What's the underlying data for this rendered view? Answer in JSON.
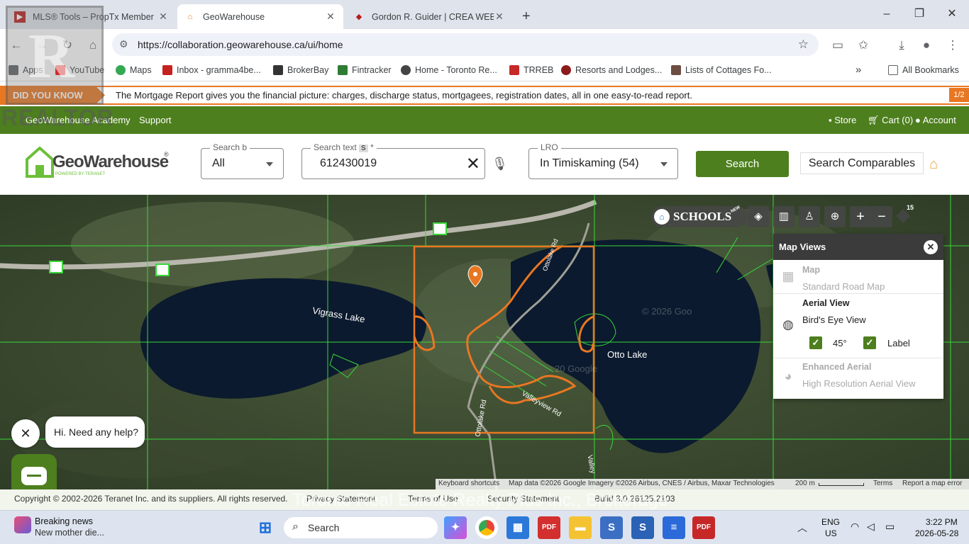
{
  "browser": {
    "tabs": [
      {
        "title": "MLS® Tools – PropTx Member",
        "active": false
      },
      {
        "title": "GeoWarehouse",
        "active": true
      },
      {
        "title": "Gordon R. Guider | CREA WEBF",
        "active": false
      }
    ],
    "new_tab": "+",
    "window_controls": {
      "minimize": "–",
      "maximize": "❐",
      "close": "✕"
    },
    "url": "https://collaboration.geowarehouse.ca/ui/home",
    "bookmarks": [
      {
        "label": "Apps",
        "color": "#5f6368"
      },
      {
        "label": "YouTube",
        "color": "#ff0000"
      },
      {
        "label": "Maps",
        "color": "#34a853"
      },
      {
        "label": "Inbox - gramma4be...",
        "color": "#c5221f"
      },
      {
        "label": "BrokerBay",
        "color": "#333333"
      },
      {
        "label": "Fintracker",
        "color": "#2e7d32"
      },
      {
        "label": "Home - Toronto Re...",
        "color": "#444444"
      },
      {
        "label": "TRREB",
        "color": "#c62828"
      },
      {
        "label": "Resorts and Lodges...",
        "color": "#8d1b1b"
      },
      {
        "label": "Lists of Cottages Fo...",
        "color": "#6d4c41"
      }
    ],
    "bookmarks_overflow": "»",
    "all_bookmarks": "All Bookmarks"
  },
  "dyk": {
    "label": "DID YOU KNOW",
    "text": "The Mortgage Report gives you the financial picture: charges, discharge status, mortgagees, registration dates, all in one easy-to-read report.",
    "page": "1/2"
  },
  "topnav": {
    "academy": "GeoWarehouse Academy",
    "support": "Support",
    "store": "Store",
    "cart": "Cart (0)",
    "account": "Account"
  },
  "logo": {
    "text": "GeoWarehouse",
    "sub": "POWERED BY TERANET",
    "reg": "®"
  },
  "search": {
    "by_label": "Search b",
    "by_value": "All",
    "text_label": "Search text",
    "text_badge": "S",
    "text_required": "*",
    "text_value": "612430019",
    "lro_label": "LRO",
    "lro_value": "In Timiskaming (54)",
    "button": "Search",
    "comparables": "Search Comparables"
  },
  "map": {
    "labels": [
      "Vigrass Lake",
      "Otto Lake",
      "Ottolake Rd",
      "Valleyview Rd",
      "Ottolake Rd",
      "Valley"
    ],
    "watermarks": [
      "© 2026 Goo",
      "20 Google"
    ],
    "schools": "SCHOOLS",
    "schools_badge": "NEW",
    "zoom_level": "15",
    "attribution": [
      "Keyboard shortcuts",
      "Map data ©2026 Google Imagery ©2026 Airbus, CNES / Airbus, Maxar Technologies",
      "200 m",
      "Terms",
      "Report a map error"
    ]
  },
  "map_views": {
    "title": "Map Views",
    "items": [
      {
        "title": "Map",
        "subtitle": "Standard Road Map",
        "enabled": false
      },
      {
        "title": "Aerial View",
        "subtitle": "Bird's Eye View",
        "enabled": true,
        "options": [
          {
            "label": "45°",
            "checked": true
          },
          {
            "label": "Label",
            "checked": true
          }
        ]
      },
      {
        "title": "Enhanced Aerial",
        "subtitle": "High Resolution Aerial View",
        "enabled": false
      }
    ]
  },
  "chat": {
    "greeting": "Hi. Need any help?"
  },
  "footer": {
    "copyright": "Copyright © 2002-2026 Teranet Inc. and its suppliers. All rights reserved.",
    "privacy": "Privacy Statement",
    "terms": "Terms of Use",
    "security": "Security Statement",
    "build": "Build 3.0.26125.2103",
    "watermark": "Toronto Real Estate Realty Plus Inc., Brokerage"
  },
  "realtor_watermark": "REALTOR",
  "taskbar": {
    "news_title": "Breaking news",
    "news_sub": "New mother die...",
    "search": "Search",
    "lang1": "ENG",
    "lang2": "US",
    "time": "3:22 PM",
    "date": "2026-05-28"
  },
  "colors": {
    "brand_green": "#4d7f1e",
    "accent_orange": "#e87722",
    "parcel_green": "#39d83b"
  }
}
